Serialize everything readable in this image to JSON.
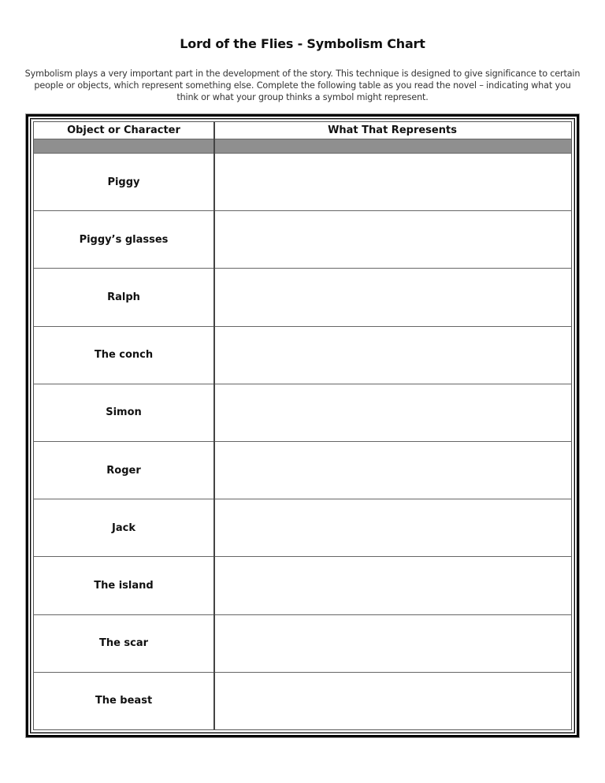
{
  "title": "Lord of the Flies - Symbolism Chart",
  "intro": "Symbolism plays a very important part in the development of the story. This technique is designed to give significance to certain people or objects, which represent something else. Complete the following table as you read the novel – indicating what you think or what your group thinks a symbol might represent.",
  "table": {
    "headers": [
      "Object or Character",
      "What That Represents"
    ],
    "rows": [
      {
        "item": "Piggy",
        "represents": ""
      },
      {
        "item": "Piggy’s glasses",
        "represents": ""
      },
      {
        "item": "Ralph",
        "represents": ""
      },
      {
        "item": "The conch",
        "represents": ""
      },
      {
        "item": "Simon",
        "represents": ""
      },
      {
        "item": "Roger",
        "represents": ""
      },
      {
        "item": "Jack",
        "represents": ""
      },
      {
        "item": "The island",
        "represents": ""
      },
      {
        "item": "The scar",
        "represents": ""
      },
      {
        "item": "The beast",
        "represents": ""
      }
    ]
  },
  "colors": {
    "header_band": "#8f8f8f",
    "border": "#000000"
  }
}
